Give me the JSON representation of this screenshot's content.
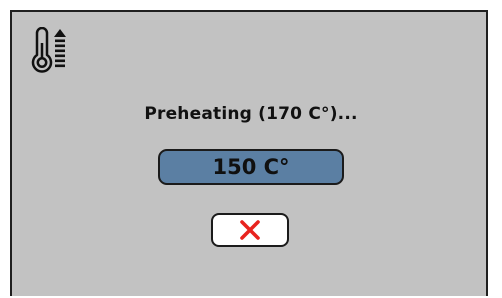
{
  "header": {
    "icon": "thermometer-rising-icon"
  },
  "status": {
    "label": "Preheating (170 C°)..."
  },
  "temperature": {
    "current": "150 C°"
  },
  "actions": {
    "cancel_icon": "close-icon",
    "cancel_color": "#e8231e"
  },
  "colors": {
    "screen_bg": "#c2c2c2",
    "display_bg": "#5b7fa3"
  }
}
